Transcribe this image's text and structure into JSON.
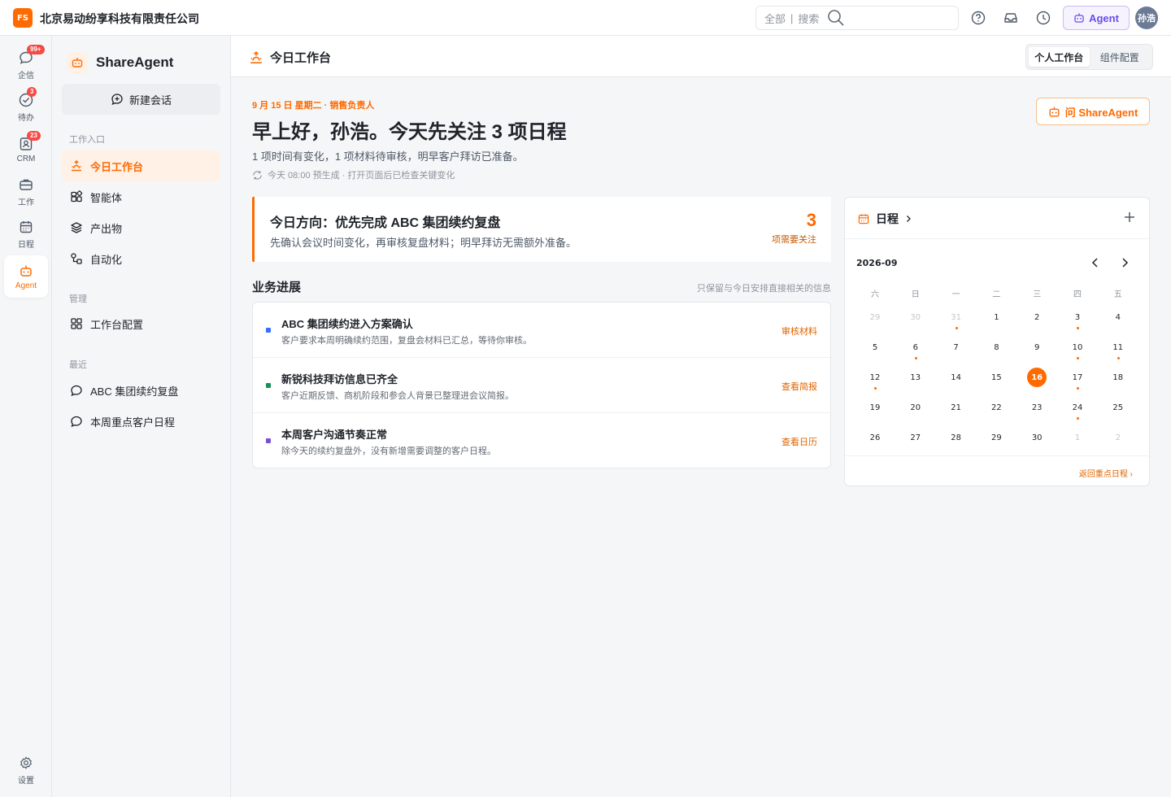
{
  "topbar": {
    "logo": "FS",
    "company": "北京易动纷享科技有限责任公司",
    "search_scope": "全部",
    "search_sep": "|",
    "search_placeholder": "搜索",
    "agent_label": "Agent",
    "avatar": "孙浩"
  },
  "rail": {
    "items": [
      {
        "label": "企信",
        "badge": "99+"
      },
      {
        "label": "待办",
        "badge": "3"
      },
      {
        "label": "CRM",
        "badge": "23"
      },
      {
        "label": "工作"
      },
      {
        "label": "日程"
      },
      {
        "label": "Agent"
      }
    ],
    "settings": "设置"
  },
  "sidebar": {
    "title": "ShareAgent",
    "new_chat": "新建会话",
    "section_entry": "工作入口",
    "entry_items": [
      "今日工作台",
      "智能体",
      "产出物",
      "自动化"
    ],
    "section_manage": "管理",
    "manage_items": [
      "工作台配置"
    ],
    "section_recent": "最近",
    "recent_items": [
      "ABC 集团续约复盘",
      "本周重点客户日程"
    ]
  },
  "main": {
    "title": "今日工作台",
    "tabs": [
      "个人工作台",
      "组件配置"
    ],
    "date_line": "9 月 15 日 星期二 · 销售负责人",
    "greeting": "早上好，孙浩。今天先关注 3 项日程",
    "subtitle": "1 项时间有变化，1 项材料待审核，明早客户拜访已准备。",
    "generated": "今天 08:00 预生成 · 打开页面后已检查关键变化",
    "ask_button": "问 ShareAgent"
  },
  "focus": {
    "title": "今日方向：优先完成 ABC 集团续约复盘",
    "desc": "先确认会议时间变化，再审核复盘材料；明早拜访无需额外准备。",
    "count": "3",
    "count_label": "项需要关注"
  },
  "progress": {
    "title": "业务进展",
    "note": "只保留与今日安排直接相关的信息",
    "rows": [
      {
        "name": "ABC 集团续约进入方案确认",
        "desc": "客户要求本周明确续约范围，复盘会材料已汇总，等待你审核。",
        "action": "审核材料",
        "color": "#3370ff"
      },
      {
        "name": "新锐科技拜访信息已齐全",
        "desc": "客户近期反馈、商机阶段和参会人背景已整理进会议简报。",
        "action": "查看简报",
        "color": "#1a8f5a"
      },
      {
        "name": "本周客户沟通节奏正常",
        "desc": "除今天的续约复盘外，没有新增需要调整的客户日程。",
        "action": "查看日历",
        "color": "#7a4fd6"
      }
    ]
  },
  "calendar": {
    "title": "日程",
    "month": "2026-09",
    "weekdays": [
      "六",
      "日",
      "一",
      "二",
      "三",
      "四",
      "五"
    ],
    "days": [
      {
        "d": "29",
        "dim": true
      },
      {
        "d": "30",
        "dim": true
      },
      {
        "d": "31",
        "dim": true,
        "dot": true
      },
      {
        "d": "1"
      },
      {
        "d": "2"
      },
      {
        "d": "3",
        "dot": true
      },
      {
        "d": "4"
      },
      {
        "d": "5"
      },
      {
        "d": "6",
        "dot": true
      },
      {
        "d": "7"
      },
      {
        "d": "8"
      },
      {
        "d": "9"
      },
      {
        "d": "10",
        "dot": true
      },
      {
        "d": "11",
        "dot": true
      },
      {
        "d": "12",
        "dot": true
      },
      {
        "d": "13"
      },
      {
        "d": "14"
      },
      {
        "d": "15"
      },
      {
        "d": "16",
        "today": true
      },
      {
        "d": "17",
        "dot": true
      },
      {
        "d": "18"
      },
      {
        "d": "19"
      },
      {
        "d": "20"
      },
      {
        "d": "21"
      },
      {
        "d": "22"
      },
      {
        "d": "23"
      },
      {
        "d": "24",
        "dot": true
      },
      {
        "d": "25"
      },
      {
        "d": "26"
      },
      {
        "d": "27"
      },
      {
        "d": "28"
      },
      {
        "d": "29"
      },
      {
        "d": "30"
      },
      {
        "d": "1",
        "dim": true
      },
      {
        "d": "2",
        "dim": true
      }
    ],
    "back_link": "返回重点日程 ›"
  },
  "colors": {
    "accent": "#ff6a00",
    "agent": "#6a4de6",
    "badge": "#f54a45"
  }
}
